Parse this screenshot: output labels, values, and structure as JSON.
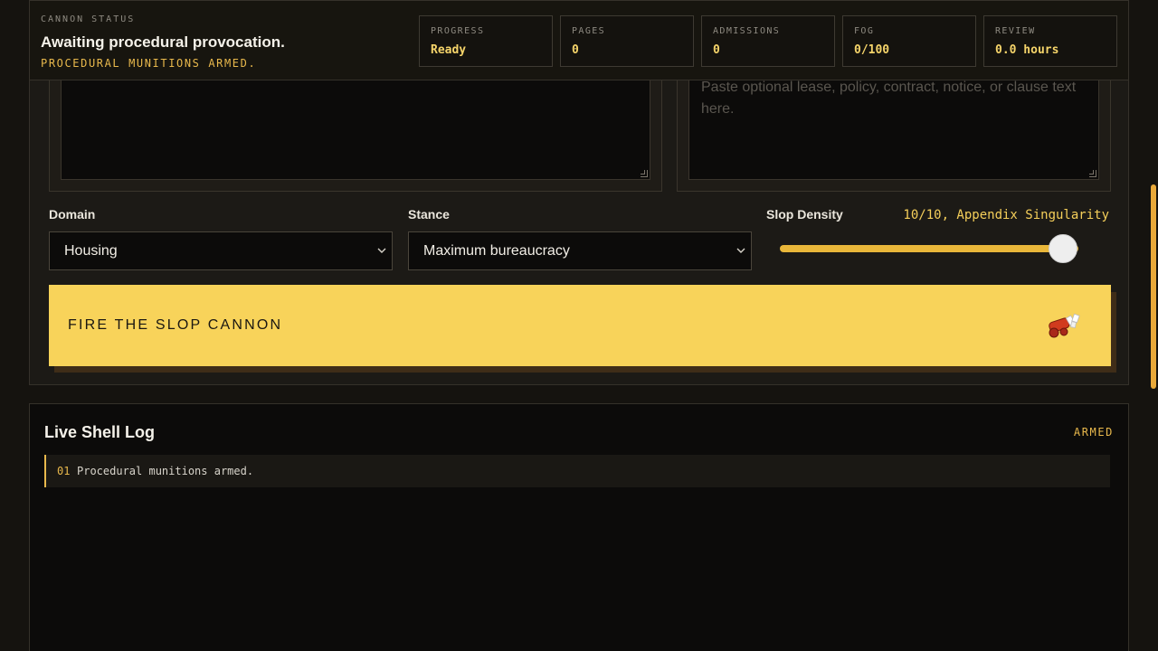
{
  "status": {
    "eyebrow": "CANNON STATUS",
    "title": "Awaiting procedural provocation.",
    "subtitle": "PROCEDURAL MUNITIONS ARMED.",
    "stats": [
      {
        "label": "PROGRESS",
        "value": "Ready"
      },
      {
        "label": "PAGES",
        "value": "0"
      },
      {
        "label": "ADMISSIONS",
        "value": "0"
      },
      {
        "label": "FOG",
        "value": "0/100"
      },
      {
        "label": "REVIEW",
        "value": "0.0 hours"
      }
    ]
  },
  "form": {
    "source_text": {
      "placeholder": "Paste optional lease, policy, contract, notice, or clause text here."
    },
    "domain": {
      "label": "Domain",
      "value": "Housing"
    },
    "stance": {
      "label": "Stance",
      "value": "Maximum bureaucracy"
    },
    "density": {
      "label": "Slop Density",
      "value_text": "10/10, Appendix Singularity",
      "value": 10,
      "max": 10
    },
    "fire_button": "FIRE THE SLOP CANNON"
  },
  "log": {
    "title": "Live Shell Log",
    "badge": "ARMED",
    "entries": [
      {
        "num": "01",
        "text": "Procedural munitions armed."
      }
    ]
  },
  "colors": {
    "accent": "#f8d35a",
    "accent_text": "#e8b84c",
    "background": "#15130f"
  }
}
